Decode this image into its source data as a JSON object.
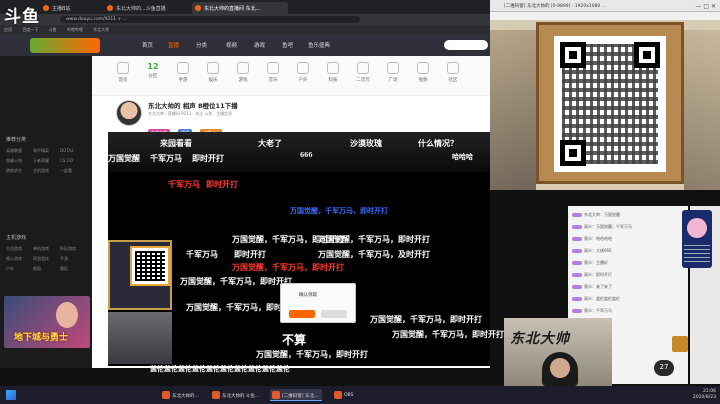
{
  "browser": {
    "tabs": [
      {
        "label": "主播B站"
      },
      {
        "label": "东北大帅的...斗鱼直播"
      },
      {
        "label": "东北大帅的直播间 东北..."
      }
    ],
    "url": "www.douyu.com/9211 + ...",
    "bookmarks": [
      "应用",
      "百度一下",
      "斗鱼",
      "哔哩哔哩",
      "东北大帅"
    ]
  },
  "logo": {
    "text": "斗鱼"
  },
  "sitenav": {
    "items": [
      "首页",
      "直播",
      "分类",
      "视频",
      "游戏",
      "鱼吧",
      "鱼乐盛典"
    ]
  },
  "sidebar": {
    "sections": [
      {
        "title": "推荐分类",
        "items": [
          "英雄联盟",
          "和平精英",
          "DOTA2",
          "穿越火线",
          "王者荣耀",
          "CS:GO",
          "绝地求生",
          "主机游戏",
          "一起看"
        ]
      },
      {
        "title": "主机游戏",
        "items": [
          "主机游戏",
          "单机游戏",
          "怀旧游戏",
          "格斗游戏",
          "网游竞技",
          "手游",
          "户外",
          "颜值",
          "舞蹈"
        ]
      }
    ],
    "thumb_label": "地下城与勇士"
  },
  "categories": {
    "count": "12",
    "items": [
      "首页",
      "分区",
      "手游",
      "娱乐",
      "游戏",
      "音乐",
      "户外",
      "科技",
      "二次元",
      "广场",
      "视频",
      "社区",
      "直播",
      "更多"
    ]
  },
  "room": {
    "title": "东北大帅的 相声 8橙位11下播",
    "subtitle": "东北大帅 · 直播间 9211 · 关注 斗鱼 · 主播信息",
    "tags": [
      "东北大帅",
      "相声",
      "主播认证"
    ]
  },
  "danmaku": [
    {
      "text": "来园看看",
      "cls": "w"
    },
    {
      "text": "大老了",
      "cls": "w"
    },
    {
      "text": "沙漠玫瑰",
      "cls": "w"
    },
    {
      "text": "什么情况？",
      "cls": "w"
    },
    {
      "text": "万国觉醒",
      "cls": "w"
    },
    {
      "text": "千军万马",
      "cls": "w"
    },
    {
      "text": "即时开打",
      "cls": "w"
    },
    {
      "text": "千军万马",
      "cls": "r"
    },
    {
      "text": "即时开打",
      "cls": "r"
    },
    {
      "text": "万国觉醒，千军万马，即时开打",
      "cls": "b"
    },
    {
      "text": "万国觉醒，千军万马，即时开打",
      "cls": "w"
    },
    {
      "text": "千军万马",
      "cls": "w"
    },
    {
      "text": "即时开打",
      "cls": "w"
    },
    {
      "text": "万国觉醒，千军万马，即时开打",
      "cls": "w"
    },
    {
      "text": "万国觉醒，千军万马，即时开打",
      "cls": "w"
    },
    {
      "text": "万国觉醒，千军万马，及时开打",
      "cls": "w"
    },
    {
      "text": "万国觉醒，千军万马，即时开打",
      "cls": "r"
    },
    {
      "text": "万国觉醒，千军万马，即时开打",
      "cls": "w"
    },
    {
      "text": "万国觉醒，千军万马，即时开打",
      "cls": "w"
    },
    {
      "text": "万国觉醒，千军万马，即时开打",
      "cls": "w"
    },
    {
      "text": "不算",
      "cls": "w"
    },
    {
      "text": "万国觉醒，千军万马，即时开打",
      "cls": "w"
    },
    {
      "text": "万国觉醒，千军万马，即时开打",
      "cls": "w"
    },
    {
      "text": "万国觉醒，千军万马",
      "cls": "w"
    },
    {
      "text": "万国觉醒，千军万马，即时开打",
      "cls": "w"
    },
    {
      "text": "盖伦盖伦盖伦盖伦盖伦盖伦盖伦盖伦盖伦盖伦",
      "cls": "w"
    },
    {
      "text": "666",
      "cls": "w"
    },
    {
      "text": "哈哈哈",
      "cls": "w"
    }
  ],
  "dialog": {
    "title": "确认领取"
  },
  "obs_window": {
    "title": "[二维码窗] 东北大帅的 [0-9899] - 1920x1080 ...",
    "controls": "— □ ✕"
  },
  "chat": {
    "lines": [
      "东北大帅：万国觉醒",
      "观众：万国觉醒，千军万马",
      "观众：哈哈哈哈",
      "观众：大佬666",
      "观众：主播好",
      "观众：即时开打",
      "观众：来了来了",
      "观众：盖伦盖伦盖伦",
      "观众：千军万马",
      "观众：万国觉醒",
      "观众：沙漠玫瑰",
      "观众：什么情况",
      "观众：来园看看"
    ],
    "online_count": "27"
  },
  "webcam": {
    "calligraphy": "东北大帅"
  },
  "taskbar": {
    "apps": [
      "东北大帅的...",
      "东北大帅的 斗鱼...",
      "[二维码窗] 东北...",
      "OBS"
    ],
    "time": "21:06",
    "date": "2020/8/23"
  }
}
